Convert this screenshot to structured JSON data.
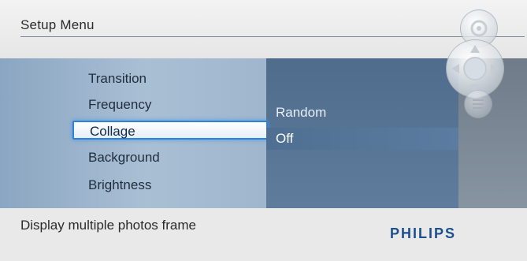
{
  "header": {
    "title": "Setup Menu"
  },
  "menu": {
    "items": [
      {
        "label": "Transition"
      },
      {
        "label": "Frequency"
      },
      {
        "label": "Collage",
        "selected": true
      },
      {
        "label": "Background"
      },
      {
        "label": "Brightness"
      }
    ]
  },
  "options": {
    "items": [
      {
        "label": "Random"
      },
      {
        "label": "Off",
        "active": true
      }
    ]
  },
  "footer": {
    "hint": "Display multiple photos frame",
    "brand": "PHILIPS"
  },
  "icons": {
    "top": "frame-control-icon",
    "middle": "dpad-icon",
    "bottom": "menu-icon"
  },
  "colors": {
    "accent": "#2f83d6",
    "brand": "#1c4f8c"
  }
}
